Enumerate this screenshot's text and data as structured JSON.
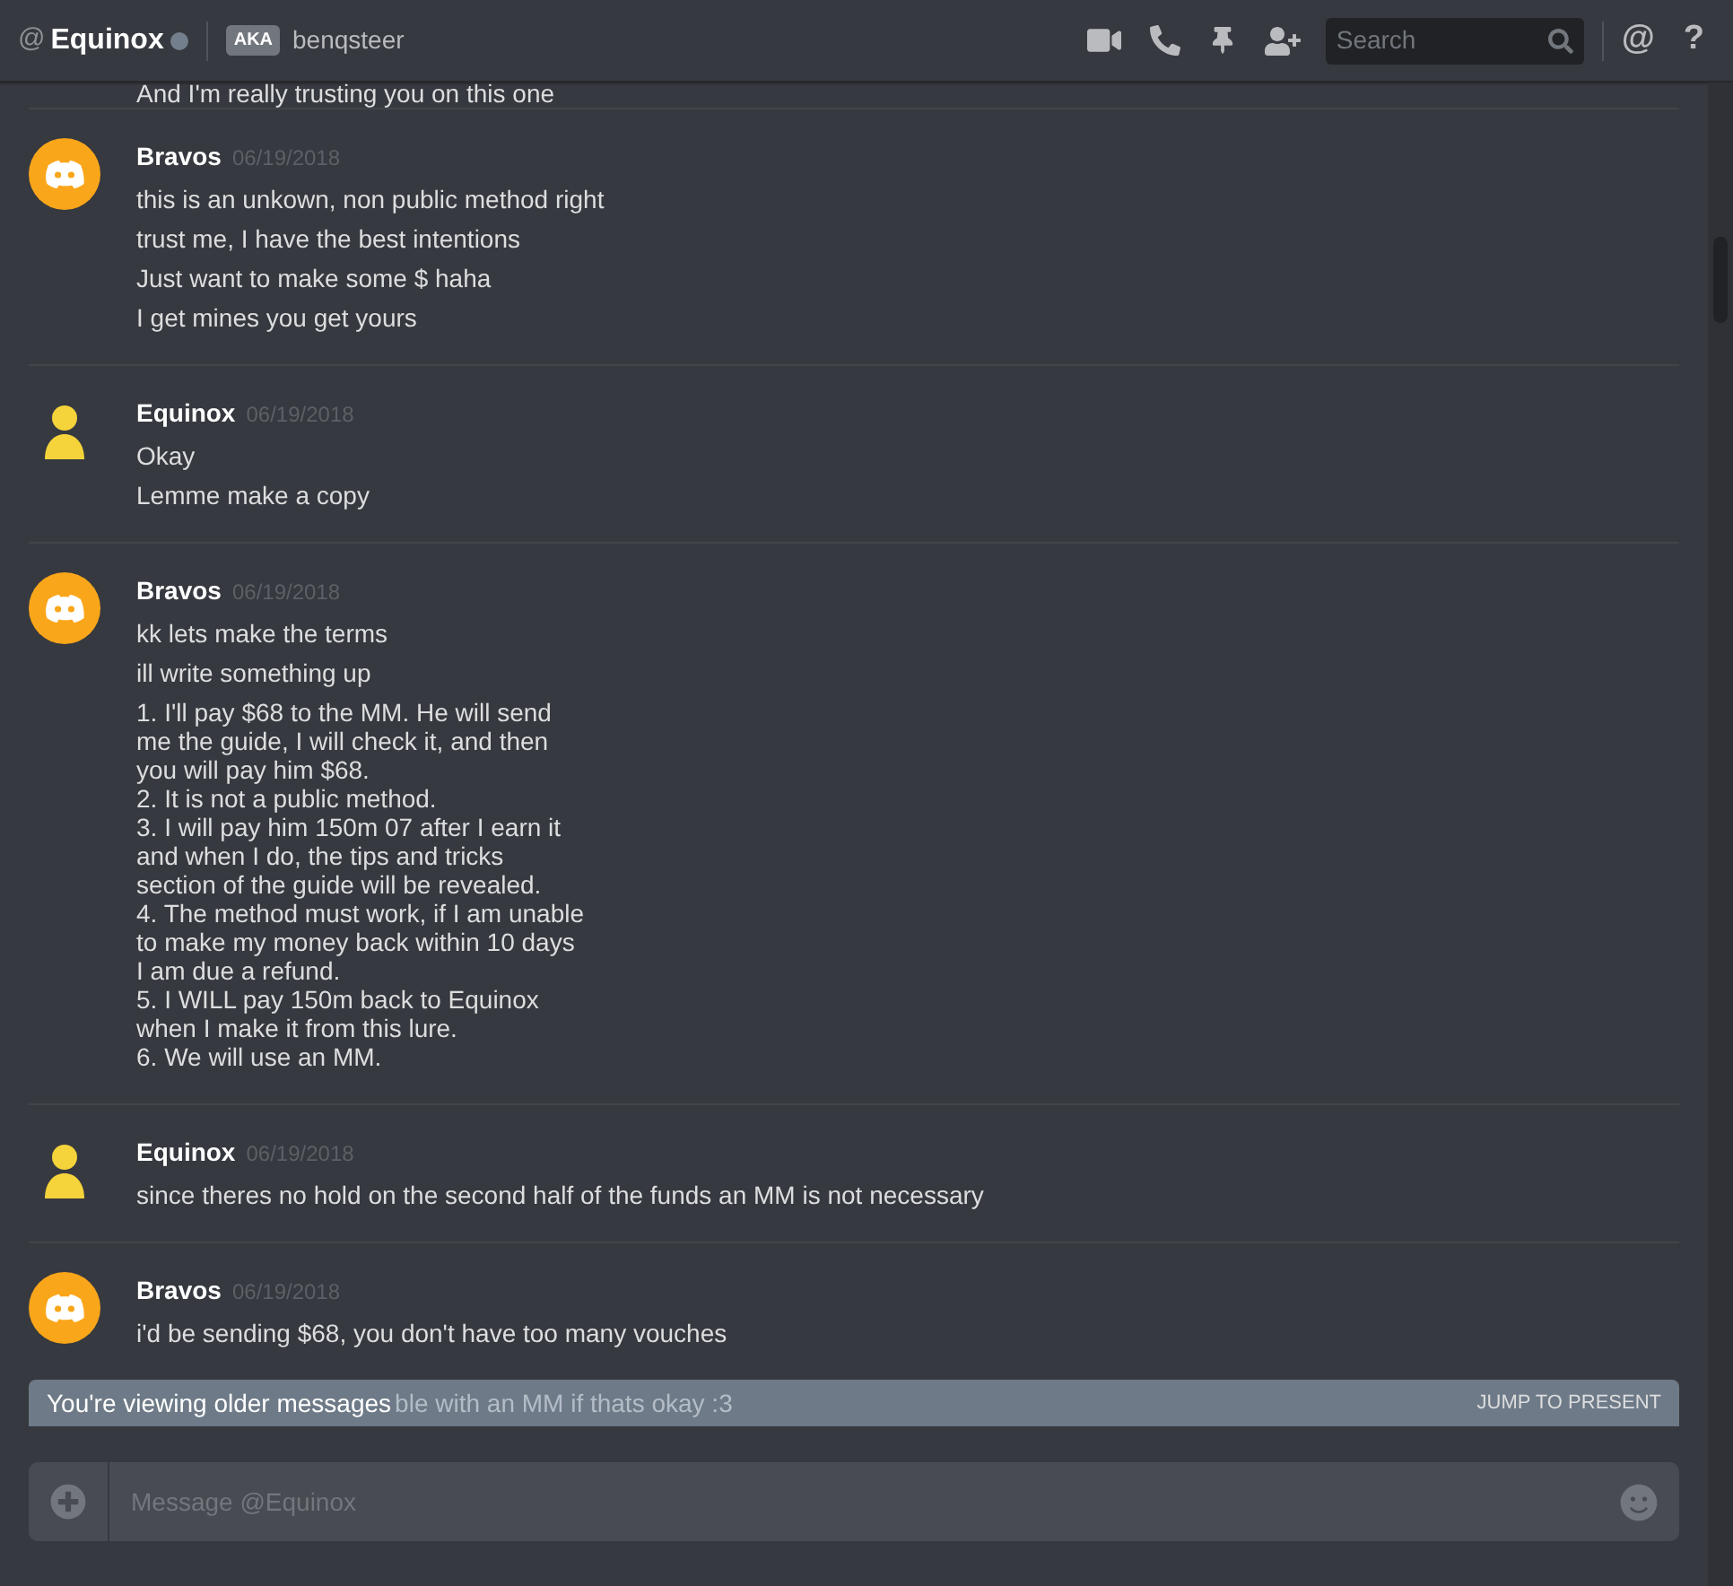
{
  "header": {
    "at": "@",
    "title": "Equinox",
    "online": false,
    "aka": "AKA",
    "nickname": "benqsteer",
    "search": {
      "placeholder": "Search"
    },
    "mention": "@",
    "help": "?"
  },
  "top_partial": "And I'm really trusting you on this one",
  "groups": [
    {
      "author": "Bravos",
      "kind": "default",
      "date": "06/19/2018",
      "messages": [
        "this is an unkown, non public method right",
        "trust me, I have the best intentions",
        "Just want to make some $ haha",
        "I get mines you get yours"
      ]
    },
    {
      "author": "Equinox",
      "kind": "custom",
      "date": "06/19/2018",
      "messages": [
        "Okay",
        "Lemme make a copy"
      ]
    },
    {
      "author": "Bravos",
      "kind": "default",
      "date": "06/19/2018",
      "messages": [
        "kk lets make the terms",
        "ill write something up",
        "1. I'll pay $68 to the MM. He will send\nme the guide, I will check it, and then\nyou will pay him $68.\n2. It is not a public method.\n3. I will pay him 150m 07 after I earn it\nand when I do, the tips and tricks\nsection of the guide will be revealed.\n4. The method must work, if I am unable\nto make my money back within 10 days\nI am due a refund.\n5. I WILL pay 150m back to Equinox\nwhen I make it from this lure.\n6. We will use an MM."
      ]
    },
    {
      "author": "Equinox",
      "kind": "custom",
      "date": "06/19/2018",
      "messages": [
        "since theres no hold on the second half of the funds an MM is not necessary"
      ]
    },
    {
      "author": "Bravos",
      "kind": "default",
      "date": "06/19/2018",
      "messages": [
        "i'd be sending $68, you don't have too many vouches"
      ]
    }
  ],
  "banner": {
    "label": "You're viewing older messages",
    "behind": "ble with an MM if thats okay :3",
    "action": "JUMP TO PRESENT"
  },
  "composer": {
    "placeholder": "Message @Equinox"
  }
}
